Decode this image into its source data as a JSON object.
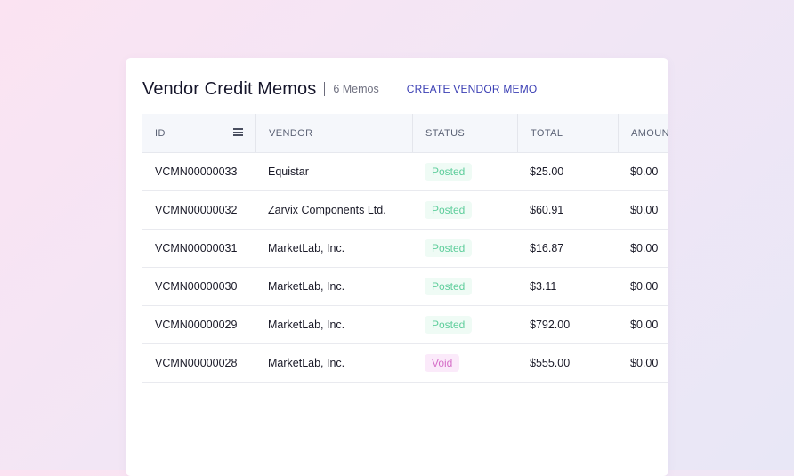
{
  "header": {
    "title": "Vendor Credit Memos",
    "count": "6 Memos",
    "create_label": "CREATE VENDOR MEMO"
  },
  "table": {
    "columns": [
      "ID",
      "VENDOR",
      "STATUS",
      "TOTAL",
      "AMOUNT"
    ],
    "rows": [
      {
        "id": "VCMN00000033",
        "vendor": "Equistar",
        "status": "Posted",
        "total": "$25.00",
        "amount": "$0.00"
      },
      {
        "id": "VCMN00000032",
        "vendor": "Zarvix Components Ltd.",
        "status": "Posted",
        "total": "$60.91",
        "amount": "$0.00"
      },
      {
        "id": "VCMN00000031",
        "vendor": "MarketLab, Inc.",
        "status": "Posted",
        "total": "$16.87",
        "amount": "$0.00"
      },
      {
        "id": "VCMN00000030",
        "vendor": "MarketLab, Inc.",
        "status": "Posted",
        "total": "$3.11",
        "amount": "$0.00"
      },
      {
        "id": "VCMN00000029",
        "vendor": "MarketLab, Inc.",
        "status": "Posted",
        "total": "$792.00",
        "amount": "$0.00"
      },
      {
        "id": "VCMN00000028",
        "vendor": "MarketLab, Inc.",
        "status": "Void",
        "total": "$555.00",
        "amount": "$0.00"
      }
    ]
  },
  "colors": {
    "accent": "#3b3fb4",
    "posted": "#5fce9c",
    "void": "#d66fc8"
  },
  "icons": {
    "column_menu": "menu-icon"
  }
}
